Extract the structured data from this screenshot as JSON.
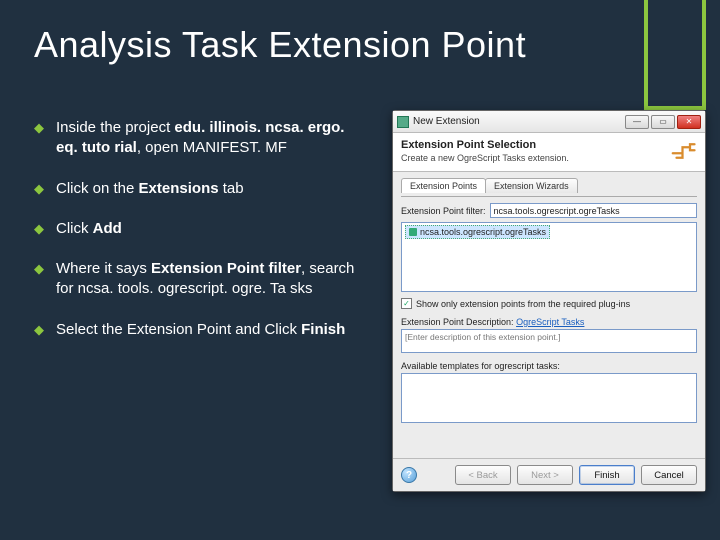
{
  "slide": {
    "title": "Analysis Task Extension Point",
    "bullets": [
      {
        "pre": "Inside the project ",
        "bold": "edu. illinois. ncsa. ergo. eq. tuto rial",
        "post": ", open MANIFEST. MF"
      },
      {
        "pre": "Click on the ",
        "bold": "Extensions",
        "post": " tab"
      },
      {
        "pre": "Click ",
        "bold": "Add",
        "post": ""
      },
      {
        "pre": "Where it says ",
        "bold": "Extension Point filter",
        "post": ", search for ncsa. tools. ogrescript. ogre. Ta sks"
      },
      {
        "pre": "Select the Extension Point and Click ",
        "bold": "Finish",
        "post": ""
      }
    ]
  },
  "dialog": {
    "window_title": "New Extension",
    "header_title": "Extension Point Selection",
    "header_sub": "Create a new OgreScript Tasks extension.",
    "tabs": {
      "t1": "Extension Points",
      "t2": "Extension Wizards"
    },
    "filter_label": "Extension Point filter:",
    "filter_value": "ncsa.tools.ogrescript.ogreTasks",
    "list_item": "ncsa.tools.ogrescript.ogreTasks",
    "checkbox_label": "Show only extension points from the required plug-ins",
    "desc_label_pre": "Extension Point Description: ",
    "desc_link": "OgreScript Tasks",
    "desc_placeholder": "[Enter description of this extension point.]",
    "templ_label": "Available templates for ogrescript tasks:",
    "buttons": {
      "back": "< Back",
      "next": "Next >",
      "finish": "Finish",
      "cancel": "Cancel"
    }
  }
}
